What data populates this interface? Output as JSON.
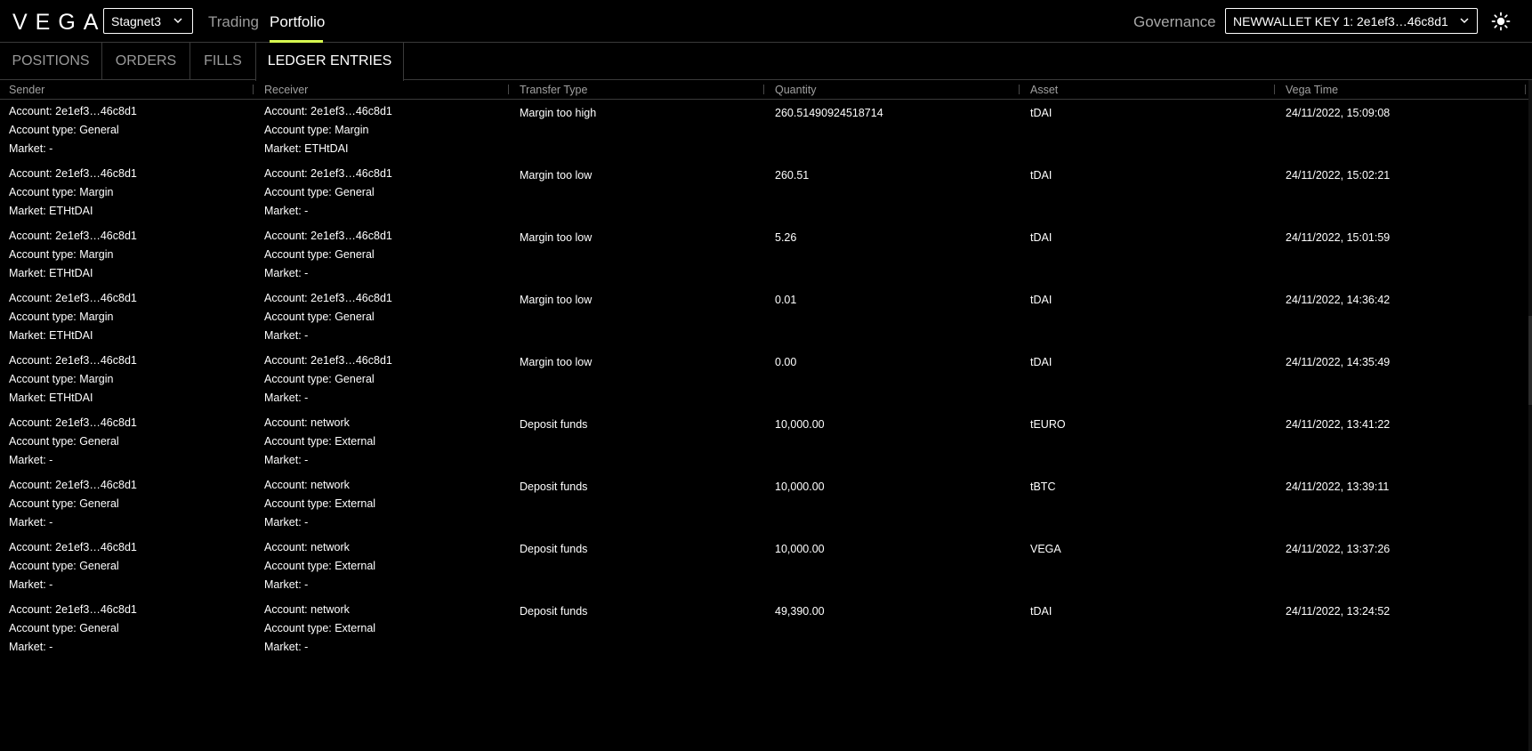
{
  "app": {
    "logo": "VEGA",
    "network": "Stagnet3",
    "nav": [
      {
        "label": "Trading",
        "active": false
      },
      {
        "label": "Portfolio",
        "active": true
      }
    ],
    "governance": "Governance",
    "wallet_key": "NEWWALLET KEY 1: 2e1ef3…46c8d1",
    "accent_color": "#d7fb50"
  },
  "tabs": [
    {
      "label": "POSITIONS",
      "active": false
    },
    {
      "label": "ORDERS",
      "active": false
    },
    {
      "label": "FILLS",
      "active": false
    },
    {
      "label": "LEDGER ENTRIES",
      "active": true
    }
  ],
  "table": {
    "columns": [
      "Sender",
      "Receiver",
      "Transfer Type",
      "Quantity",
      "Asset",
      "Vega Time"
    ],
    "rows": [
      {
        "sender": [
          "Account: 2e1ef3…46c8d1",
          "Account type: General",
          "Market: -"
        ],
        "receiver": [
          "Account: 2e1ef3…46c8d1",
          "Account type: Margin",
          "Market: ETHtDAI"
        ],
        "type": "Margin too high",
        "quantity": "260.51490924518714",
        "asset": "tDAI",
        "time": "24/11/2022, 15:09:08"
      },
      {
        "sender": [
          "Account: 2e1ef3…46c8d1",
          "Account type: Margin",
          "Market: ETHtDAI"
        ],
        "receiver": [
          "Account: 2e1ef3…46c8d1",
          "Account type: General",
          "Market: -"
        ],
        "type": "Margin too low",
        "quantity": "260.51",
        "asset": "tDAI",
        "time": "24/11/2022, 15:02:21"
      },
      {
        "sender": [
          "Account: 2e1ef3…46c8d1",
          "Account type: Margin",
          "Market: ETHtDAI"
        ],
        "receiver": [
          "Account: 2e1ef3…46c8d1",
          "Account type: General",
          "Market: -"
        ],
        "type": "Margin too low",
        "quantity": "5.26",
        "asset": "tDAI",
        "time": "24/11/2022, 15:01:59"
      },
      {
        "sender": [
          "Account: 2e1ef3…46c8d1",
          "Account type: Margin",
          "Market: ETHtDAI"
        ],
        "receiver": [
          "Account: 2e1ef3…46c8d1",
          "Account type: General",
          "Market: -"
        ],
        "type": "Margin too low",
        "quantity": "0.01",
        "asset": "tDAI",
        "time": "24/11/2022, 14:36:42"
      },
      {
        "sender": [
          "Account: 2e1ef3…46c8d1",
          "Account type: Margin",
          "Market: ETHtDAI"
        ],
        "receiver": [
          "Account: 2e1ef3…46c8d1",
          "Account type: General",
          "Market: -"
        ],
        "type": "Margin too low",
        "quantity": "0.00",
        "asset": "tDAI",
        "time": "24/11/2022, 14:35:49"
      },
      {
        "sender": [
          "Account: 2e1ef3…46c8d1",
          "Account type: General",
          "Market: -"
        ],
        "receiver": [
          "Account: network",
          "Account type: External",
          "Market: -"
        ],
        "type": "Deposit funds",
        "quantity": "10,000.00",
        "asset": "tEURO",
        "time": "24/11/2022, 13:41:22"
      },
      {
        "sender": [
          "Account: 2e1ef3…46c8d1",
          "Account type: General",
          "Market: -"
        ],
        "receiver": [
          "Account: network",
          "Account type: External",
          "Market: -"
        ],
        "type": "Deposit funds",
        "quantity": "10,000.00",
        "asset": "tBTC",
        "time": "24/11/2022, 13:39:11"
      },
      {
        "sender": [
          "Account: 2e1ef3…46c8d1",
          "Account type: General",
          "Market: -"
        ],
        "receiver": [
          "Account: network",
          "Account type: External",
          "Market: -"
        ],
        "type": "Deposit funds",
        "quantity": "10,000.00",
        "asset": "VEGA",
        "time": "24/11/2022, 13:37:26"
      },
      {
        "sender": [
          "Account: 2e1ef3…46c8d1",
          "Account type: General",
          "Market: -"
        ],
        "receiver": [
          "Account: network",
          "Account type: External",
          "Market: -"
        ],
        "type": "Deposit funds",
        "quantity": "49,390.00",
        "asset": "tDAI",
        "time": "24/11/2022, 13:24:52"
      }
    ]
  }
}
